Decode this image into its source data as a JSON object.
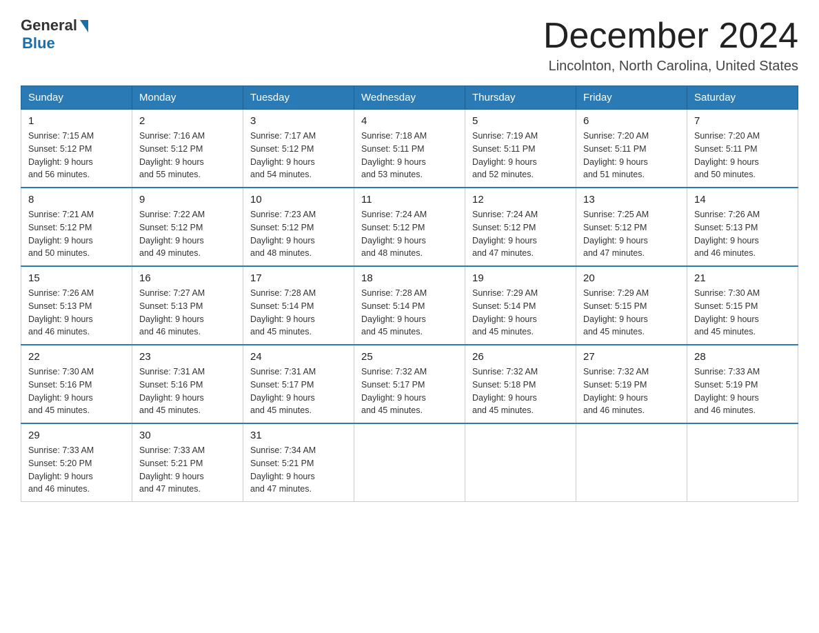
{
  "logo": {
    "general": "General",
    "blue": "Blue"
  },
  "header": {
    "month": "December 2024",
    "location": "Lincolnton, North Carolina, United States"
  },
  "days_of_week": [
    "Sunday",
    "Monday",
    "Tuesday",
    "Wednesday",
    "Thursday",
    "Friday",
    "Saturday"
  ],
  "weeks": [
    [
      {
        "day": "1",
        "sunrise": "7:15 AM",
        "sunset": "5:12 PM",
        "daylight": "9 hours and 56 minutes."
      },
      {
        "day": "2",
        "sunrise": "7:16 AM",
        "sunset": "5:12 PM",
        "daylight": "9 hours and 55 minutes."
      },
      {
        "day": "3",
        "sunrise": "7:17 AM",
        "sunset": "5:12 PM",
        "daylight": "9 hours and 54 minutes."
      },
      {
        "day": "4",
        "sunrise": "7:18 AM",
        "sunset": "5:11 PM",
        "daylight": "9 hours and 53 minutes."
      },
      {
        "day": "5",
        "sunrise": "7:19 AM",
        "sunset": "5:11 PM",
        "daylight": "9 hours and 52 minutes."
      },
      {
        "day": "6",
        "sunrise": "7:20 AM",
        "sunset": "5:11 PM",
        "daylight": "9 hours and 51 minutes."
      },
      {
        "day": "7",
        "sunrise": "7:20 AM",
        "sunset": "5:11 PM",
        "daylight": "9 hours and 50 minutes."
      }
    ],
    [
      {
        "day": "8",
        "sunrise": "7:21 AM",
        "sunset": "5:12 PM",
        "daylight": "9 hours and 50 minutes."
      },
      {
        "day": "9",
        "sunrise": "7:22 AM",
        "sunset": "5:12 PM",
        "daylight": "9 hours and 49 minutes."
      },
      {
        "day": "10",
        "sunrise": "7:23 AM",
        "sunset": "5:12 PM",
        "daylight": "9 hours and 48 minutes."
      },
      {
        "day": "11",
        "sunrise": "7:24 AM",
        "sunset": "5:12 PM",
        "daylight": "9 hours and 48 minutes."
      },
      {
        "day": "12",
        "sunrise": "7:24 AM",
        "sunset": "5:12 PM",
        "daylight": "9 hours and 47 minutes."
      },
      {
        "day": "13",
        "sunrise": "7:25 AM",
        "sunset": "5:12 PM",
        "daylight": "9 hours and 47 minutes."
      },
      {
        "day": "14",
        "sunrise": "7:26 AM",
        "sunset": "5:13 PM",
        "daylight": "9 hours and 46 minutes."
      }
    ],
    [
      {
        "day": "15",
        "sunrise": "7:26 AM",
        "sunset": "5:13 PM",
        "daylight": "9 hours and 46 minutes."
      },
      {
        "day": "16",
        "sunrise": "7:27 AM",
        "sunset": "5:13 PM",
        "daylight": "9 hours and 46 minutes."
      },
      {
        "day": "17",
        "sunrise": "7:28 AM",
        "sunset": "5:14 PM",
        "daylight": "9 hours and 45 minutes."
      },
      {
        "day": "18",
        "sunrise": "7:28 AM",
        "sunset": "5:14 PM",
        "daylight": "9 hours and 45 minutes."
      },
      {
        "day": "19",
        "sunrise": "7:29 AM",
        "sunset": "5:14 PM",
        "daylight": "9 hours and 45 minutes."
      },
      {
        "day": "20",
        "sunrise": "7:29 AM",
        "sunset": "5:15 PM",
        "daylight": "9 hours and 45 minutes."
      },
      {
        "day": "21",
        "sunrise": "7:30 AM",
        "sunset": "5:15 PM",
        "daylight": "9 hours and 45 minutes."
      }
    ],
    [
      {
        "day": "22",
        "sunrise": "7:30 AM",
        "sunset": "5:16 PM",
        "daylight": "9 hours and 45 minutes."
      },
      {
        "day": "23",
        "sunrise": "7:31 AM",
        "sunset": "5:16 PM",
        "daylight": "9 hours and 45 minutes."
      },
      {
        "day": "24",
        "sunrise": "7:31 AM",
        "sunset": "5:17 PM",
        "daylight": "9 hours and 45 minutes."
      },
      {
        "day": "25",
        "sunrise": "7:32 AM",
        "sunset": "5:17 PM",
        "daylight": "9 hours and 45 minutes."
      },
      {
        "day": "26",
        "sunrise": "7:32 AM",
        "sunset": "5:18 PM",
        "daylight": "9 hours and 45 minutes."
      },
      {
        "day": "27",
        "sunrise": "7:32 AM",
        "sunset": "5:19 PM",
        "daylight": "9 hours and 46 minutes."
      },
      {
        "day": "28",
        "sunrise": "7:33 AM",
        "sunset": "5:19 PM",
        "daylight": "9 hours and 46 minutes."
      }
    ],
    [
      {
        "day": "29",
        "sunrise": "7:33 AM",
        "sunset": "5:20 PM",
        "daylight": "9 hours and 46 minutes."
      },
      {
        "day": "30",
        "sunrise": "7:33 AM",
        "sunset": "5:21 PM",
        "daylight": "9 hours and 47 minutes."
      },
      {
        "day": "31",
        "sunrise": "7:34 AM",
        "sunset": "5:21 PM",
        "daylight": "9 hours and 47 minutes."
      },
      null,
      null,
      null,
      null
    ]
  ],
  "labels": {
    "sunrise": "Sunrise: ",
    "sunset": "Sunset: ",
    "daylight": "Daylight: "
  }
}
